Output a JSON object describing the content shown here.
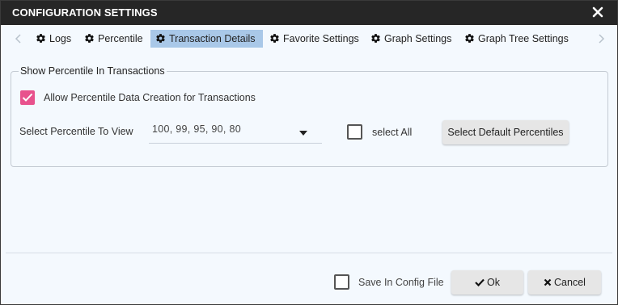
{
  "dialog": {
    "title": "CONFIGURATION SETTINGS",
    "close_icon": "close-icon"
  },
  "tabs": [
    {
      "label": "Logs",
      "icon": "gear-icon",
      "active": false
    },
    {
      "label": "Percentile",
      "icon": "gear-icon",
      "active": false
    },
    {
      "label": "Transaction Details",
      "icon": "gear-icon",
      "active": true
    },
    {
      "label": "Favorite Settings",
      "icon": "gear-icon",
      "active": false
    },
    {
      "label": "Graph Settings",
      "icon": "gear-icon",
      "active": false
    },
    {
      "label": "Graph Tree Settings",
      "icon": "gear-icon",
      "active": false
    }
  ],
  "section": {
    "legend": "Show Percentile In Transactions",
    "allow_checkbox": {
      "label": "Allow Percentile Data Creation for Transactions",
      "checked": true
    },
    "select_label": "Select Percentile To View",
    "dropdown_value": "100,  99,  95,  90,  80",
    "select_all": {
      "label": "select All",
      "checked": false
    },
    "default_button": "Select Default Percentiles"
  },
  "footer": {
    "save_checkbox": {
      "label": "Save In Config File",
      "checked": false
    },
    "ok_label": "Ok",
    "cancel_label": "Cancel"
  },
  "colors": {
    "titlebar": "#262626",
    "active_tab": "#a9c8e8",
    "checkbox_checked": "#e8528d",
    "dialog_bg": "#f4f9fe"
  }
}
